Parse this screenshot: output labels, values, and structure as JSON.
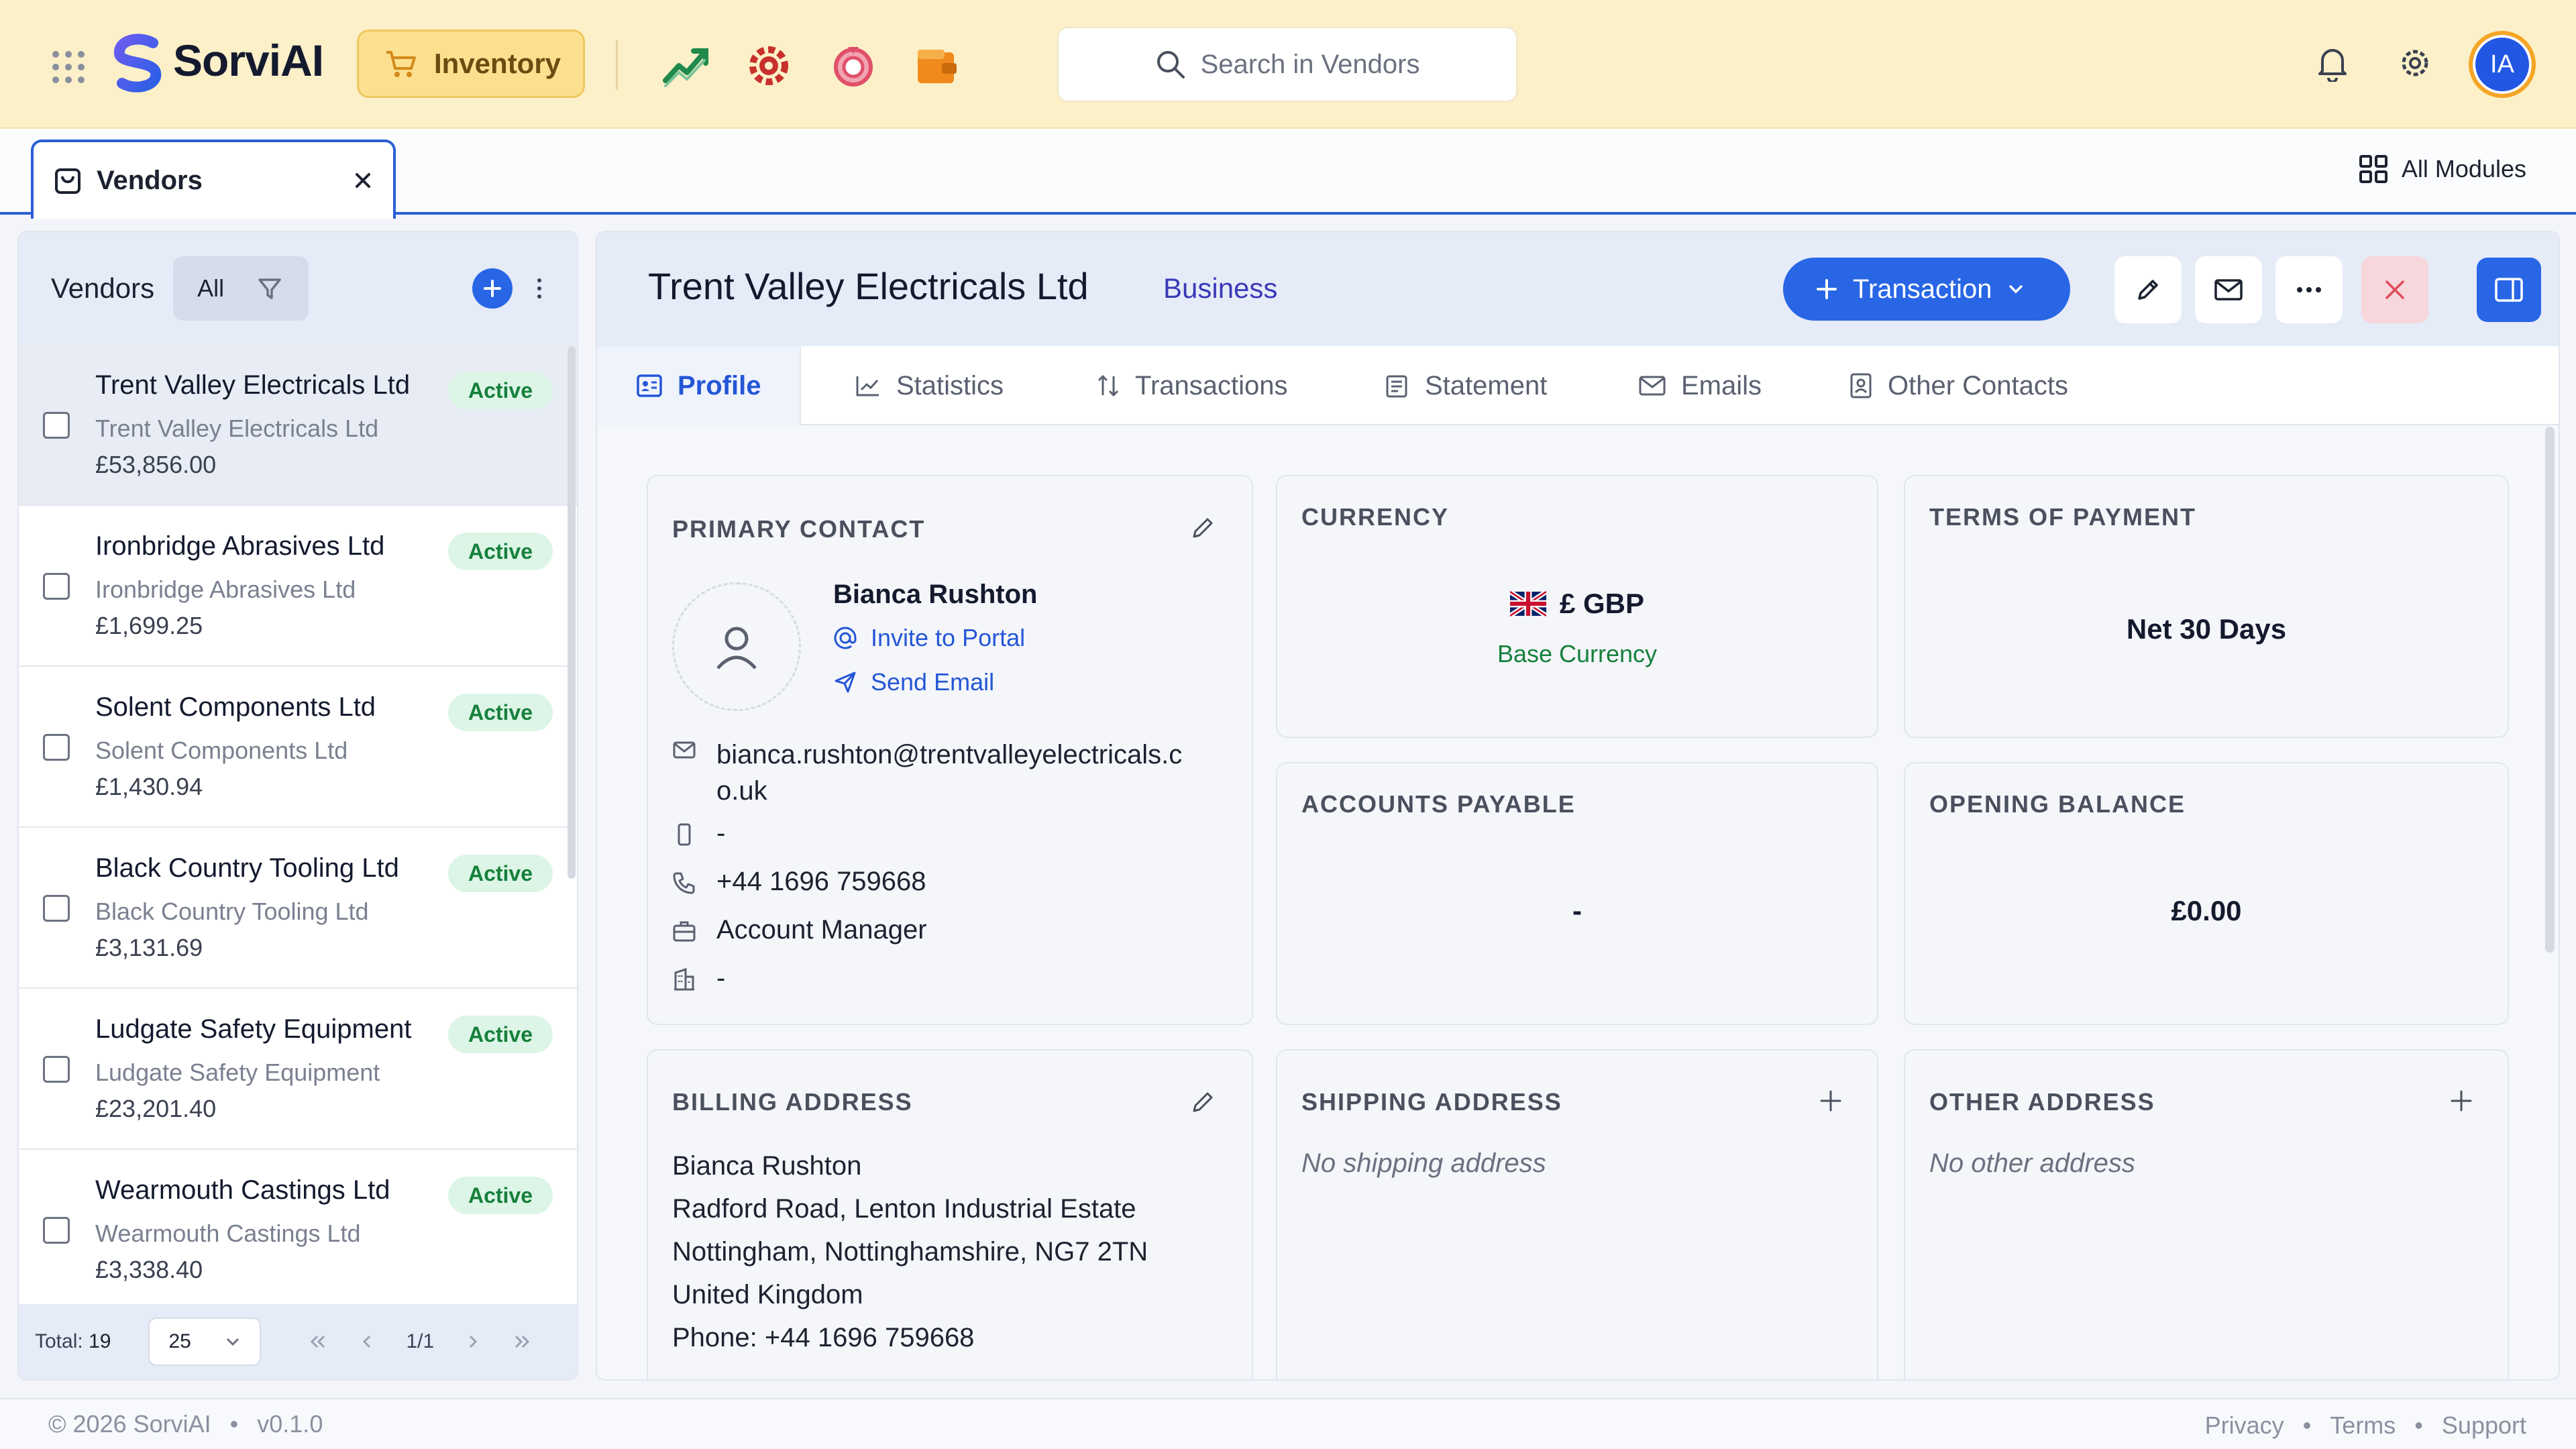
{
  "app": {
    "name": "SorviAI",
    "module": "Inventory",
    "search_placeholder": "Search in Vendors",
    "user_initials": "IA",
    "colors": {
      "accent": "#2866e6",
      "topbar": "#fbf0c8",
      "active_green": "#16803c"
    }
  },
  "tabs": {
    "open_tab": "Vendors",
    "all_modules": "All Modules"
  },
  "vendor_list": {
    "title": "Vendors",
    "filter": "All",
    "rows": [
      {
        "name": "Trent Valley Electricals Ltd",
        "company": "Trent Valley Electricals Ltd",
        "amount": "£53,856.00",
        "status": "Active"
      },
      {
        "name": "Ironbridge Abrasives Ltd",
        "company": "Ironbridge Abrasives Ltd",
        "amount": "£1,699.25",
        "status": "Active"
      },
      {
        "name": "Solent Components Ltd",
        "company": "Solent Components Ltd",
        "amount": "£1,430.94",
        "status": "Active"
      },
      {
        "name": "Black Country Tooling Ltd",
        "company": "Black Country Tooling Ltd",
        "amount": "£3,131.69",
        "status": "Active"
      },
      {
        "name": "Ludgate Safety Equipment",
        "company": "Ludgate Safety Equipment",
        "amount": "£23,201.40",
        "status": "Active"
      },
      {
        "name": "Wearmouth Castings Ltd",
        "company": "Wearmouth Castings Ltd",
        "amount": "£3,338.40",
        "status": "Active"
      }
    ],
    "footer": {
      "total_label": "Total:",
      "total": "19",
      "per_page": "25",
      "page": "1/1"
    }
  },
  "detail": {
    "vendor_name": "Trent Valley Electricals Ltd",
    "vendor_type": "Business",
    "transaction_button": "Transaction",
    "tabs": [
      "Profile",
      "Statistics",
      "Transactions",
      "Statement",
      "Emails",
      "Other Contacts"
    ],
    "primary_contact": {
      "title": "PRIMARY CONTACT",
      "name": "Bianca Rushton",
      "invite": "Invite to Portal",
      "send_email": "Send Email",
      "email_line1": "bianca.rushton@trentvalleyelectricals.c",
      "email_line2": "o.uk",
      "mobile": "-",
      "phone": "+44 1696 759668",
      "job_title": "Account Manager",
      "department": "-"
    },
    "currency": {
      "title": "CURRENCY",
      "value": "£ GBP",
      "note": "Base Currency"
    },
    "terms": {
      "title": "TERMS OF PAYMENT",
      "value": "Net 30 Days"
    },
    "accounts_payable": {
      "title": "ACCOUNTS PAYABLE",
      "value": "-"
    },
    "opening_balance": {
      "title": "OPENING BALANCE",
      "value": "£0.00"
    },
    "billing": {
      "title": "BILLING ADDRESS",
      "lines": [
        "Bianca Rushton",
        "Radford Road, Lenton Industrial Estate",
        "Nottingham, Nottinghamshire, NG7 2TN",
        "United Kingdom",
        "Phone: +44 1696 759668"
      ]
    },
    "shipping": {
      "title": "SHIPPING ADDRESS",
      "empty": "No shipping address"
    },
    "other": {
      "title": "OTHER ADDRESS",
      "empty": "No other address"
    }
  },
  "footer": {
    "copyright": "© 2026 SorviAI",
    "version": "v0.1.0",
    "links": [
      "Privacy",
      "Terms",
      "Support"
    ]
  }
}
